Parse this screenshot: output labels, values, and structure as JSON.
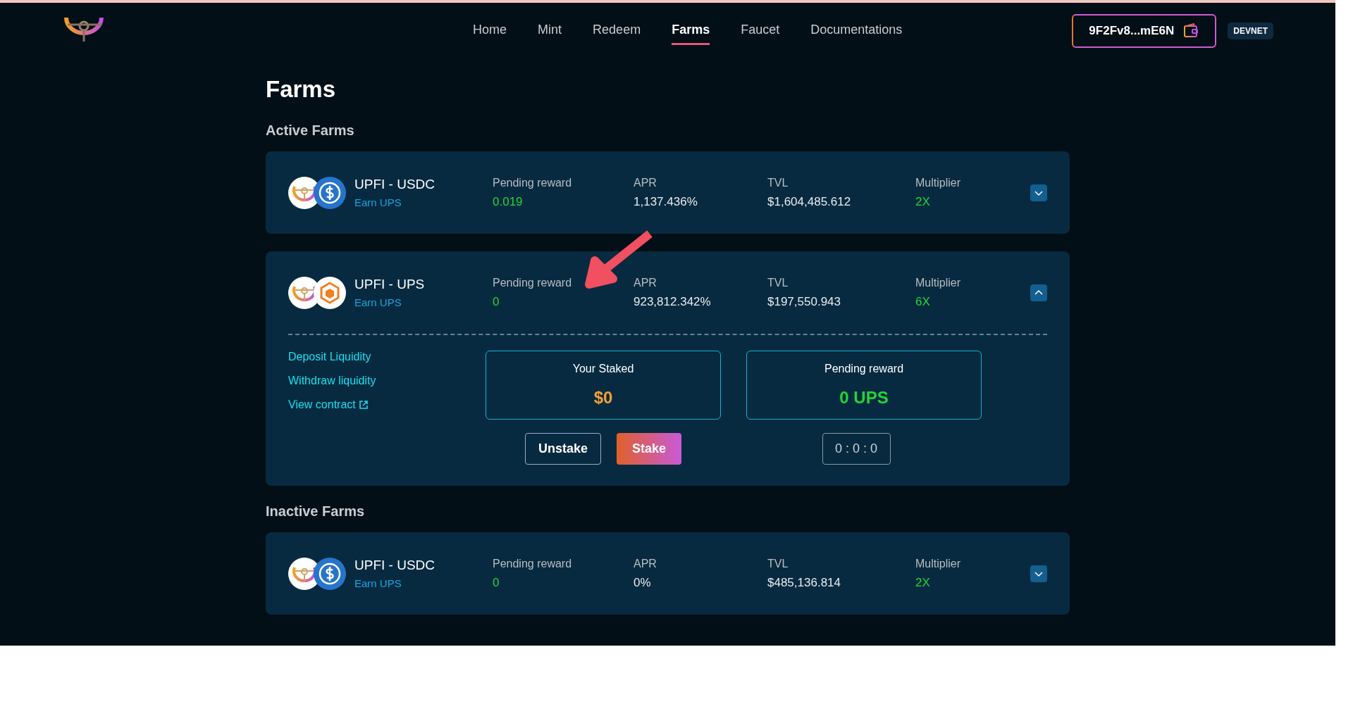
{
  "nav": [
    {
      "label": "Home",
      "selected": false
    },
    {
      "label": "Mint",
      "selected": false
    },
    {
      "label": "Redeem",
      "selected": false
    },
    {
      "label": "Farms",
      "selected": true
    },
    {
      "label": "Faucet",
      "selected": false
    },
    {
      "label": "Documentations",
      "selected": false
    }
  ],
  "wallet": {
    "address": "9F2Fv8...mE6N"
  },
  "network": "DEVNET",
  "page_title": "Farms",
  "sections": [
    {
      "title": "Active Farms",
      "farms": [
        {
          "pair": "UPFI - USDC",
          "quote_icon": {
            "kind": "usdc"
          },
          "earn": "Earn UPS",
          "stats": [
            {
              "label": "Pending reward",
              "value": "0.019",
              "kind": "green"
            },
            {
              "label": "APR",
              "value": "1,137.436%",
              "kind": "plain"
            },
            {
              "label": "TVL",
              "value": "$1,604,485.612",
              "kind": "plain"
            },
            {
              "label": "Multiplier",
              "value": "2X",
              "kind": "green"
            }
          ],
          "expanded": false
        },
        {
          "pair": "UPFI - UPS",
          "quote_icon": {
            "kind": "ups"
          },
          "earn": "Earn UPS",
          "stats": [
            {
              "label": "Pending reward",
              "value": "0",
              "kind": "green"
            },
            {
              "label": "APR",
              "value": "923,812.342%",
              "kind": "plain"
            },
            {
              "label": "TVL",
              "value": "$197,550.943",
              "kind": "plain"
            },
            {
              "label": "Multiplier",
              "value": "6X",
              "kind": "green"
            }
          ],
          "expanded": true,
          "details": {
            "links": [
              "Deposit Liquidity",
              "Withdraw liquidity",
              "View contract"
            ],
            "staked": {
              "label": "Your Staked",
              "value": "$0"
            },
            "pending": {
              "label": "Pending reward",
              "value": "0 UPS"
            },
            "buttons": [
              {
                "label": "Unstake",
                "kind": "outline"
              },
              {
                "label": "Stake",
                "kind": "gradient"
              }
            ],
            "timer": "0 : 0 : 0"
          }
        }
      ]
    },
    {
      "title": "Inactive Farms",
      "farms": [
        {
          "pair": "UPFI - USDC",
          "quote_icon": {
            "kind": "usdc"
          },
          "earn": "Earn UPS",
          "stats": [
            {
              "label": "Pending reward",
              "value": "0",
              "kind": "green"
            },
            {
              "label": "APR",
              "value": "0%",
              "kind": "plain"
            },
            {
              "label": "TVL",
              "value": "$485,136.814",
              "kind": "plain"
            },
            {
              "label": "Multiplier",
              "value": "2X",
              "kind": "green"
            }
          ],
          "expanded": false
        }
      ]
    }
  ]
}
